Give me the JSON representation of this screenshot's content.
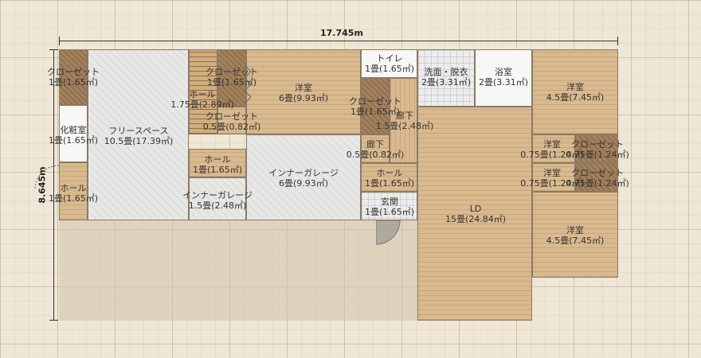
{
  "dimensions": {
    "width_label": "17.745m",
    "height_label": "8.645m"
  },
  "rooms": {
    "closet_left": {
      "name": "クローゼット",
      "size": "1畳(1.65㎡)"
    },
    "vanity": {
      "name": "化粧室",
      "size": "1畳(1.65㎡)"
    },
    "hall_left": {
      "name": "ホール",
      "size": "1畳(1.65㎡)"
    },
    "free_space": {
      "name": "フリースペース",
      "size": "10.5畳(17.39㎡)"
    },
    "hall_stairs": {
      "name": "ホール",
      "size": "1.75畳(2.89㎡)"
    },
    "closet_mid_top": {
      "name": "クローゼット",
      "size": "1畳(1.65㎡)"
    },
    "closet_mid_small": {
      "name": "クローゼット",
      "size": "0.5畳(0.82㎡)"
    },
    "hall_mid": {
      "name": "ホール",
      "size": "1畳(1.65㎡)"
    },
    "inner_garage_small": {
      "name": "インナーガレージ",
      "size": "1.5畳(2.48㎡)"
    },
    "western_mid": {
      "name": "洋室",
      "size": "6畳(9.93㎡)"
    },
    "inner_garage": {
      "name": "インナーガレージ",
      "size": "6畳(9.93㎡)"
    },
    "toilet": {
      "name": "トイレ",
      "size": "1畳(1.65㎡)"
    },
    "closet_center": {
      "name": "クローゼット",
      "size": "1畳(1.65㎡)"
    },
    "corridor_a": {
      "name": "廊下",
      "size": "1.5畳(2.48㎡)"
    },
    "corridor_b": {
      "name": "廊下",
      "size": "0.5畳(0.82㎡)"
    },
    "hall_center": {
      "name": "ホール",
      "size": "1畳(1.65㎡)"
    },
    "entrance": {
      "name": "玄関",
      "size": "1畳(1.65㎡)"
    },
    "washroom": {
      "name": "洗面・脱衣",
      "size": "2畳(3.31㎡)"
    },
    "bathroom": {
      "name": "浴室",
      "size": "2畳(3.31㎡)"
    },
    "ld": {
      "name": "LD",
      "size": "15畳(24.84㎡)"
    },
    "western_right_top": {
      "name": "洋室",
      "size": "4.5畳(7.45㎡)"
    },
    "western_small_a": {
      "name": "洋室",
      "size": "0.75畳(1.24㎡)"
    },
    "closet_right_a": {
      "name": "クローゼット",
      "size": "0.75畳(1.24㎡)"
    },
    "western_small_b": {
      "name": "洋室",
      "size": "0.75畳(1.24㎡)"
    },
    "closet_right_b": {
      "name": "クローゼット",
      "size": "0.75畳(1.24㎡)"
    },
    "western_right_bottom": {
      "name": "洋室",
      "size": "4.5畳(7.45㎡)"
    }
  }
}
